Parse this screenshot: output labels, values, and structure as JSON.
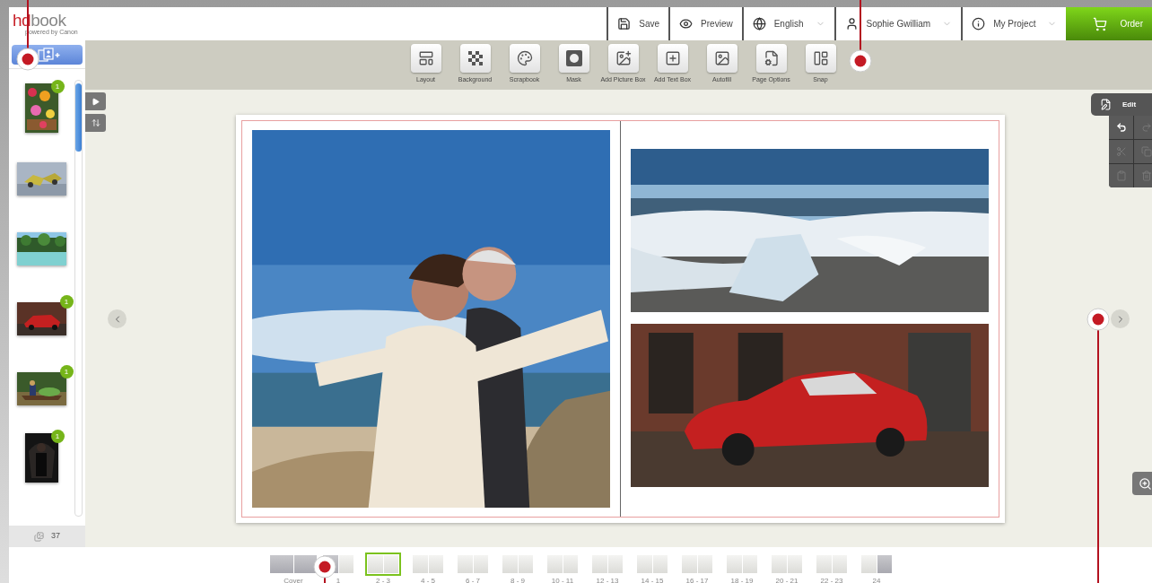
{
  "logo": {
    "prefix": "hd",
    "suffix": "book",
    "tagline": "powered by Canon"
  },
  "header_buttons": [
    {
      "kind": "save",
      "label": "Save",
      "dropdown": false
    },
    {
      "kind": "preview",
      "label": "Preview",
      "dropdown": false
    },
    {
      "kind": "language",
      "label": "English",
      "dropdown": true
    },
    {
      "kind": "user",
      "label": "Sophie Gwilliam",
      "dropdown": true
    },
    {
      "kind": "project",
      "label": "My Project",
      "dropdown": true
    },
    {
      "kind": "order",
      "label": "Order",
      "dropdown": false
    }
  ],
  "toolbar": [
    {
      "kind": "layout",
      "label": "Layout"
    },
    {
      "kind": "background",
      "label": "Background"
    },
    {
      "kind": "scrapbook",
      "label": "Scrapbook"
    },
    {
      "kind": "mask",
      "label": "Mask"
    },
    {
      "kind": "picture_box",
      "label": "Add Picture Box"
    },
    {
      "kind": "text_box",
      "label": "Add Text Box"
    },
    {
      "kind": "autofill",
      "label": "Autofill"
    },
    {
      "kind": "page_options",
      "label": "Page Options"
    },
    {
      "kind": "snap",
      "label": "Snap"
    }
  ],
  "sidebar": {
    "photos": [
      {
        "kind": "portrait",
        "badge": "1"
      },
      {
        "kind": "landscape"
      },
      {
        "kind": "landscape"
      },
      {
        "kind": "landscape",
        "badge": "1"
      },
      {
        "kind": "landscape",
        "badge": "1"
      },
      {
        "kind": "portrait",
        "badge": "1"
      }
    ],
    "photo_count": "37"
  },
  "editor": {
    "title": "Edit",
    "tools": [
      {
        "kind": "undo",
        "disabled": false
      },
      {
        "kind": "redo",
        "disabled": true
      },
      {
        "kind": "cut",
        "disabled": true
      },
      {
        "kind": "copy",
        "disabled": true
      },
      {
        "kind": "paste",
        "disabled": true
      },
      {
        "kind": "delete",
        "disabled": true
      }
    ]
  },
  "pages": [
    {
      "label": "Cover",
      "kind": "cover",
      "selected": false
    },
    {
      "label": "1",
      "kind": "first",
      "selected": false
    },
    {
      "label": "2 - 3",
      "kind": "spread",
      "selected": true
    },
    {
      "label": "4 - 5",
      "kind": "spread",
      "selected": false
    },
    {
      "label": "6 - 7",
      "kind": "spread",
      "selected": false
    },
    {
      "label": "8 - 9",
      "kind": "spread",
      "selected": false
    },
    {
      "label": "10 - 11",
      "kind": "spread",
      "selected": false
    },
    {
      "label": "12 - 13",
      "kind": "spread",
      "selected": false
    },
    {
      "label": "14 - 15",
      "kind": "spread",
      "selected": false
    },
    {
      "label": "16 - 17",
      "kind": "spread",
      "selected": false
    },
    {
      "label": "18 - 19",
      "kind": "spread",
      "selected": false
    },
    {
      "label": "20 - 21",
      "kind": "spread",
      "selected": false
    },
    {
      "label": "22 - 23",
      "kind": "spread",
      "selected": false
    },
    {
      "label": "24",
      "kind": "last",
      "selected": false
    }
  ]
}
